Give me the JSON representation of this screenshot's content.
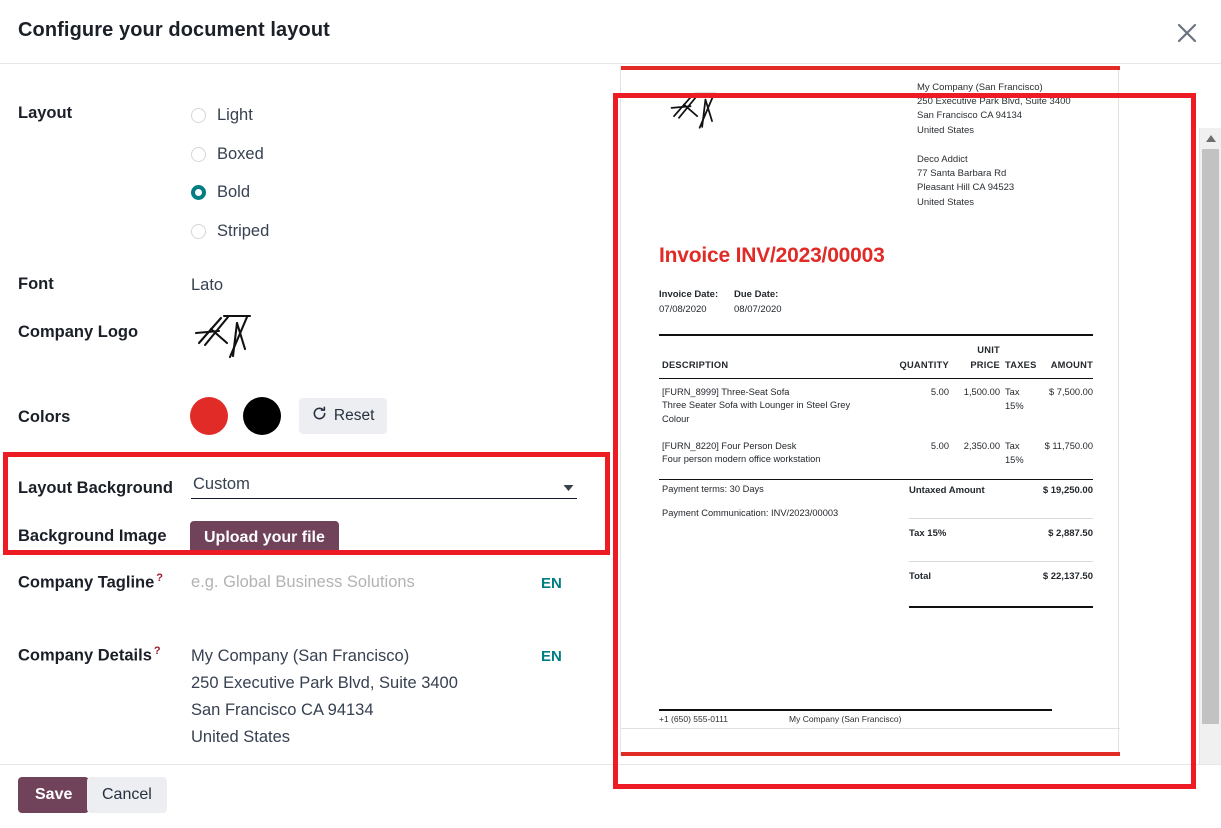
{
  "header": {
    "title": "Configure your document layout",
    "close_icon": "close-icon"
  },
  "form": {
    "layout": {
      "label": "Layout",
      "options": [
        {
          "label": "Light",
          "selected": false
        },
        {
          "label": "Boxed",
          "selected": false
        },
        {
          "label": "Bold",
          "selected": true
        },
        {
          "label": "Striped",
          "selected": false
        }
      ]
    },
    "font": {
      "label": "Font",
      "value": "Lato"
    },
    "company_logo": {
      "label": "Company Logo",
      "icon": "company-logo-scribble"
    },
    "colors": {
      "label": "Colors",
      "primary": "#E02B27",
      "secondary": "#000000",
      "reset_label": "Reset",
      "reset_icon": "refresh-icon"
    },
    "layout_background": {
      "label": "Layout Background",
      "value": "Custom",
      "caret_icon": "chevron-down-icon"
    },
    "background_image": {
      "label": "Background Image",
      "upload_label": "Upload your file"
    },
    "company_tagline": {
      "label": "Company Tagline",
      "help": "?",
      "value": "",
      "placeholder": "e.g. Global Business Solutions",
      "lang": "EN"
    },
    "company_details": {
      "label": "Company Details",
      "help": "?",
      "value": "My Company (San Francisco)\n250 Executive Park Blvd, Suite 3400\nSan Francisco CA 94134\nUnited States",
      "lang": "EN"
    }
  },
  "footer": {
    "save_label": "Save",
    "cancel_label": "Cancel"
  },
  "scrollbar": {
    "up_icon": "scroll-up-arrow-icon",
    "down_icon": "scroll-down-arrow-icon"
  },
  "preview": {
    "accent_color": "#E02B27",
    "company_address": "My Company (San Francisco)\n250 Executive Park Blvd, Suite 3400\nSan Francisco CA 94134\nUnited States",
    "customer_address": "Deco Addict\n77 Santa Barbara Rd\nPleasant Hill CA 94523\nUnited States",
    "title": "Invoice INV/2023/00003",
    "invoice_date_label": "Invoice Date:",
    "invoice_date": "07/08/2020",
    "due_date_label": "Due Date:",
    "due_date": "08/07/2020",
    "columns": {
      "description": "DESCRIPTION",
      "quantity": "QUANTITY",
      "unit_price_line1": "UNIT",
      "unit_price_line2": "PRICE",
      "taxes": "TAXES",
      "amount": "AMOUNT"
    },
    "lines": [
      {
        "description": "[FURN_8999] Three-Seat Sofa",
        "sub": "Three Seater Sofa with Lounger in Steel Grey\nColour",
        "quantity": "5.00",
        "unit_price": "1,500.00",
        "taxes": "Tax\n15%",
        "amount": "$ 7,500.00"
      },
      {
        "description": "[FURN_8220] Four Person Desk",
        "sub": "Four person modern office workstation",
        "quantity": "5.00",
        "unit_price": "2,350.00",
        "taxes": "Tax\n15%",
        "amount": "$ 11,750.00"
      }
    ],
    "payment_terms": "Payment terms: 30 Days",
    "payment_communication": "Payment Communication: INV/2023/00003",
    "totals": [
      {
        "label": "Untaxed Amount",
        "value": "$ 19,250.00"
      },
      {
        "label": "Tax 15%",
        "value": "$ 2,887.50"
      },
      {
        "label": "Total",
        "value": "$ 22,137.50"
      }
    ],
    "footer_phone": "+1 (650) 555-0111",
    "footer_company": "My Company (San Francisco)"
  }
}
